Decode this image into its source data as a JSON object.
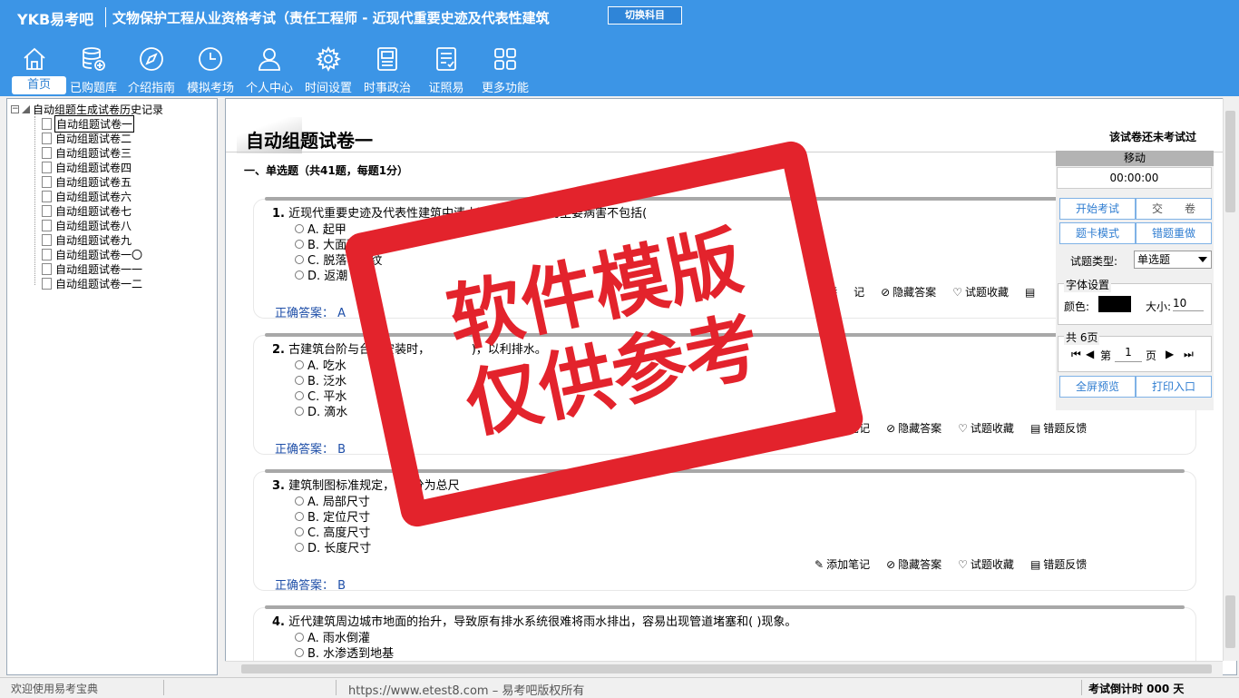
{
  "header": {
    "brand": "YKB易考吧",
    "title": "文物保护工程从业资格考试（责任工程师 - 近现代重要史迹及代表性建筑",
    "switch_label": "切换科目",
    "nav": [
      {
        "label": "首页",
        "icon": "home-icon"
      },
      {
        "label": "已购题库",
        "icon": "database-icon"
      },
      {
        "label": "介绍指南",
        "icon": "compass-icon"
      },
      {
        "label": "模拟考场",
        "icon": "clock-icon"
      },
      {
        "label": "个人中心",
        "icon": "user-icon"
      },
      {
        "label": "时间设置",
        "icon": "gear-icon"
      },
      {
        "label": "时事政治",
        "icon": "news-icon"
      },
      {
        "label": "证照易",
        "icon": "checklist-icon"
      },
      {
        "label": "更多功能",
        "icon": "grid-icon"
      }
    ]
  },
  "tree": {
    "root": "自动组题生成试卷历史记录",
    "items": [
      "自动组题试卷一",
      "自动组题试卷二",
      "自动组题试卷三",
      "自动组题试卷四",
      "自动组题试卷五",
      "自动组题试卷六",
      "自动组题试卷七",
      "自动组题试卷八",
      "自动组题试卷九",
      "自动组题试卷一〇",
      "自动组题试卷一一",
      "自动组题试卷一二"
    ]
  },
  "main": {
    "doc_title": "自动组题试卷一",
    "status": "该试卷还未考试过",
    "section": "一、单选题（共41题，每题1分）",
    "actions": {
      "note": "添加笔记",
      "hide": "隐藏答案",
      "fav": "试题收藏",
      "report": "错题反馈",
      "note_partial": "添",
      "note_partial2": "记"
    },
    "answer_label": "正确答案：",
    "questions": [
      {
        "num": "1.",
        "text": "近现代重要史迹及代表性建筑中清水砖墙容易出现的主要病害不包括(",
        "options": [
          "A. 起甲",
          "B. 大面积泛碱",
          "C. 脱落、裂纹",
          "D. 返潮"
        ],
        "answer": "A"
      },
      {
        "num": "2.",
        "text": "古建筑台阶与台",
        "text2": "安装时，",
        "text3": ")，以利排水。",
        "options": [
          "A. 吃水",
          "B. 泛水",
          "C. 平水",
          "D. 滴水"
        ],
        "answer": "B"
      },
      {
        "num": "3.",
        "text": "建筑制图标准规定，",
        "text2": "寸分为总尺",
        "text3": "]。",
        "options": [
          "A. 局部尺寸",
          "B. 定位尺寸",
          "C. 高度尺寸",
          "D. 长度尺寸"
        ],
        "answer": "B"
      },
      {
        "num": "4.",
        "text": "近代建筑周边城市地面的抬升，导致原有排水系统很难将雨水排出，容易出现管道堵塞和(  )现象。",
        "options": [
          "A. 雨水倒灌",
          "B. 水渗透到地基"
        ]
      }
    ]
  },
  "side": {
    "move": "移动",
    "timer": "00:00:00",
    "start": "开始考试",
    "submit": "交　　卷",
    "card": "题卡模式",
    "redo": "错题重做",
    "type_label": "试题类型:",
    "type_value": "单选题",
    "font_group": "字体设置",
    "color_label": "颜色:",
    "size_label": "大小:",
    "size_value": "10",
    "page_group": "共 6页",
    "page_prefix": "第",
    "page_value": "1",
    "page_suffix": "页",
    "fullscreen": "全屏预览",
    "print": "打印入口"
  },
  "stamp": {
    "line1": "软件模版",
    "line2": "仅供参考"
  },
  "footer": {
    "welcome": "欢迎使用易考宝典",
    "copyright": "https://www.etest8.com – 易考吧版权所有",
    "countdown": "考试倒计时 000 天"
  }
}
